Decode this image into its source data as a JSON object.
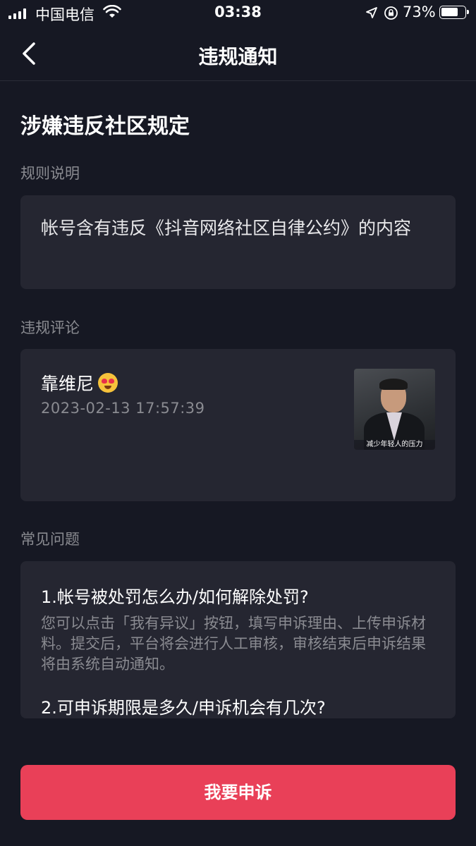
{
  "status_bar": {
    "carrier": "中国电信",
    "time": "03:38",
    "battery_percent": "73%",
    "battery_level": 0.73
  },
  "nav": {
    "title": "违规通知"
  },
  "headline": "涉嫌违反社区规定",
  "rule_section": {
    "label": "规则说明",
    "text": "帐号含有违反《抖音网络社区自律公约》的内容"
  },
  "comment_section": {
    "label": "违规评论",
    "author": "靠维尼",
    "timestamp": "2023-02-13 17:57:39",
    "thumbnail_caption": "减少年轻人的压力"
  },
  "faq_section": {
    "label": "常见问题",
    "items": [
      {
        "question": "1.帐号被处罚怎么办/如何解除处罚?",
        "answer": "您可以点击「我有异议」按钮，填写申诉理由、上传申诉材料。提交后，平台将会进行人工审核，审核结束后申诉结果将由系统自动通知。"
      },
      {
        "question": "2.可申诉期限是多久/申诉机会有几次?",
        "answer": ""
      }
    ]
  },
  "appeal_button": "我要申诉",
  "colors": {
    "background": "#161823",
    "card": "#252631",
    "accent": "#e94058",
    "muted_text": "#8a8b91"
  }
}
